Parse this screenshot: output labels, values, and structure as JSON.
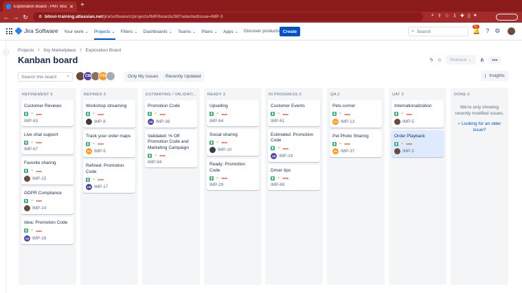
{
  "browser": {
    "tab_title": "Exploration Board - PMT Board",
    "tab_close": "✕",
    "new_tab": "+",
    "url_host": "bitovi-training.atlassian.net",
    "url_path": "/jira/software/c/projects/IMP/boards/36?selectedIssue=IMP-3"
  },
  "header": {
    "logo_text": "Jira Software",
    "nav": [
      "Your work",
      "Projects",
      "Filters",
      "Dashboards",
      "Teams",
      "Plans",
      "Apps",
      "Discover products"
    ],
    "create_label": "Create",
    "search_placeholder": "Search",
    "notif_count": "9+"
  },
  "breadcrumb": [
    "Projects",
    "/",
    "Itsy Marketplace",
    "/",
    "Exploration Board"
  ],
  "page": {
    "title": "Kanban board",
    "release_label": "Release",
    "more_label": "•••",
    "search_placeholder": "Search this board",
    "only_my_issues": "Only My Issues",
    "recently_updated": "Recently Updated",
    "insights_label": "Insights"
  },
  "filter_avatars": [
    {
      "initials": "",
      "color": "#6b4c3b"
    },
    {
      "initials": "CB",
      "color": "#5243aa"
    },
    {
      "initials": "",
      "color": "#8d6e63"
    },
    {
      "initials": "PH",
      "color": "#ff991f"
    },
    {
      "initials": "",
      "color": "#a5adba"
    }
  ],
  "columns": [
    {
      "title": "REFINEMENT 5",
      "cards": [
        {
          "title": "Customer Reviews",
          "key": "IMP-63",
          "avatar": "",
          "av_color": ""
        },
        {
          "title": "Live chat support",
          "key": "IMP-67",
          "avatar": "",
          "av_color": ""
        },
        {
          "title": "Favorite sharing",
          "key": "IMP-15",
          "avatar": "",
          "av_color": "#6b4c3b"
        },
        {
          "title": "GDPR Compliance",
          "key": "IMP-14",
          "avatar": "",
          "av_color": "#6b4c3b"
        },
        {
          "title": "Idea: Promotion Code",
          "key": "IMP-18",
          "avatar": "CB",
          "av_color": "#5243aa"
        }
      ]
    },
    {
      "title": "REFINED 3",
      "cards": [
        {
          "title": "Workshop streaming",
          "key": "IMP-8",
          "avatar": "",
          "av_color": "#3d3d3d"
        },
        {
          "title": "Track your order maps",
          "key": "IMP-9",
          "avatar": "PH",
          "av_color": "#ff991f"
        },
        {
          "title": "Refined: Promotion Code",
          "key": "IMP-17",
          "avatar": "CB",
          "av_color": "#5243aa"
        }
      ]
    },
    {
      "title": "ESTIMATING / VALIDATI... 2",
      "cards": [
        {
          "title": "Promotion Code",
          "key": "IMP-38",
          "avatar": "CB",
          "av_color": "#5243aa"
        },
        {
          "title": "Validated: % Off Promotion Code and Marketing Campaign",
          "key": "IMP-94",
          "avatar": "",
          "av_color": ""
        }
      ]
    },
    {
      "title": "READY 3",
      "cards": [
        {
          "title": "Upselling",
          "key": "IMP-64",
          "avatar": "",
          "av_color": ""
        },
        {
          "title": "Social sharing",
          "key": "IMP-10",
          "avatar": "",
          "av_color": "#3d3d3d"
        },
        {
          "title": "Ready: Promotion Code",
          "key": "IMP-29",
          "avatar": "",
          "av_color": ""
        }
      ]
    },
    {
      "title": "IN PROGRESS 3",
      "cards": [
        {
          "title": "Customer Events",
          "key": "IMP-61",
          "avatar": "",
          "av_color": ""
        },
        {
          "title": "Estimated: Promotion Code",
          "key": "IMP-19",
          "avatar": "CB",
          "av_color": "#5243aa"
        },
        {
          "title": "Driver tips",
          "key": "IMP-69",
          "avatar": "",
          "av_color": ""
        }
      ]
    },
    {
      "title": "QA 2",
      "cards": [
        {
          "title": "Pets corner",
          "key": "IMP-13",
          "avatar": "PH",
          "av_color": "#ff991f"
        },
        {
          "title": "Pet Photo Sharing",
          "key": "IMP-37",
          "avatar": "PH",
          "av_color": "#ff991f"
        }
      ]
    },
    {
      "title": "UAT 2",
      "cards": [
        {
          "title": "Internationalization",
          "key": "IMP-5",
          "avatar": "",
          "av_color": "#6b4c3b"
        },
        {
          "title": "Order Playback",
          "key": "IMP-3",
          "avatar": "",
          "av_color": "#6b4c3b",
          "selected": true
        }
      ]
    },
    {
      "title": "DONE 0",
      "cards": [],
      "empty_msg": "We're only showing recently modified issues.",
      "empty_link": "Looking for an older issue?"
    }
  ]
}
